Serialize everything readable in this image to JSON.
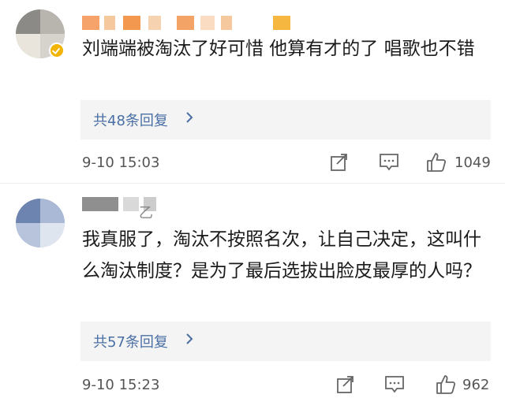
{
  "comments": [
    {
      "text": "刘端端被淘汰了好可惜 他算有才的了 唱歌也不错",
      "replies_label": "共48条回复",
      "time": "9-10 15:03",
      "likes": "1049"
    },
    {
      "username_fragment": "乙",
      "text": "我真服了，淘汰不按照名次，让自己决定，这叫什么淘汰制度？是为了最后选拔出脸皮最厚的人吗？",
      "replies_label": "共57条回复",
      "time": "9-10 15:23",
      "likes": "962"
    }
  ],
  "icons": {
    "chevron": "chevron-right-icon",
    "share": "share-icon",
    "comment": "comment-icon",
    "like": "thumbs-up-icon"
  },
  "colors": {
    "link": "#4a6fa5",
    "reply_bg": "#f4f4f4",
    "meta": "#555555",
    "badge": "#f2b400"
  }
}
